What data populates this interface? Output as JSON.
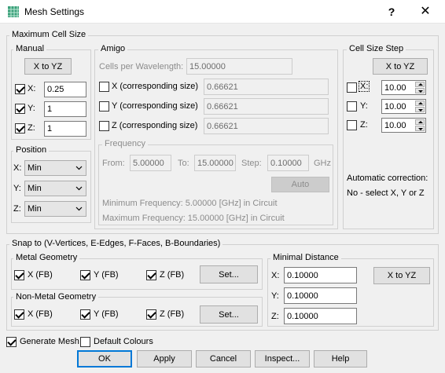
{
  "window": {
    "title": "Mesh Settings",
    "help_label": "?",
    "close_label": "✕"
  },
  "max_cell": {
    "title": "Maximum Cell Size",
    "manual": {
      "title": "Manual",
      "x_to_yz_label": "X to YZ",
      "x_label": "X:",
      "x_value": "0.25",
      "y_label": "Y:",
      "y_value": "1",
      "z_label": "Z:",
      "z_value": "1"
    },
    "position": {
      "title": "Position",
      "x_label": "X:",
      "x_value": "Min",
      "y_label": "Y:",
      "y_value": "Min",
      "z_label": "Z:",
      "z_value": "Min"
    },
    "amigo": {
      "title": "Amigo",
      "cells_label": "Cells per Wavelength:",
      "cells_value": "15.00000",
      "x_label": "X (corresponding size)",
      "x_value": "0.66621",
      "y_label": "Y (corresponding size)",
      "y_value": "0.66621",
      "z_label": "Z (corresponding size)",
      "z_value": "0.66621",
      "frequency": {
        "title": "Frequency",
        "from_label": "From:",
        "from_value": "5.00000",
        "to_label": "To:",
        "to_value": "15.00000",
        "step_label": "Step:",
        "step_value": "0.10000",
        "unit": "GHz",
        "auto_label": "Auto",
        "min_text": "Minimum Frequency: 5.00000 [GHz] in Circuit",
        "max_text": "Maximum Frequency: 15.00000 [GHz] in Circuit"
      }
    },
    "cell_step": {
      "title": "Cell Size Step",
      "x_to_yz_label": "X to YZ",
      "x_label": "X:",
      "x_value": "10.00",
      "y_label": "Y:",
      "y_value": "10.00",
      "z_label": "Z:",
      "z_value": "10.00",
      "auto_line1": "Automatic correction:",
      "auto_line2": "No - select X, Y or Z"
    }
  },
  "snap": {
    "title": "Snap to (V-Vertices, E-Edges, F-Faces, B-Boundaries)",
    "metal": {
      "title": "Metal Geometry",
      "x_label": "X (FB)",
      "y_label": "Y (FB)",
      "z_label": "Z (FB)",
      "set_label": "Set..."
    },
    "nonmetal": {
      "title": "Non-Metal Geometry",
      "x_label": "X (FB)",
      "y_label": "Y (FB)",
      "z_label": "Z (FB)",
      "set_label": "Set..."
    },
    "min_distance": {
      "title": "Minimal Distance",
      "x_label": "X:",
      "x_value": "0.10000",
      "y_label": "Y:",
      "y_value": "0.10000",
      "z_label": "Z:",
      "z_value": "0.10000",
      "x_to_yz_label": "X to YZ"
    }
  },
  "options": {
    "generate_mesh_label": "Generate Mesh",
    "default_colours_label": "Default Colours"
  },
  "buttons": {
    "ok": "OK",
    "apply": "Apply",
    "cancel": "Cancel",
    "inspect": "Inspect...",
    "help": "Help"
  }
}
